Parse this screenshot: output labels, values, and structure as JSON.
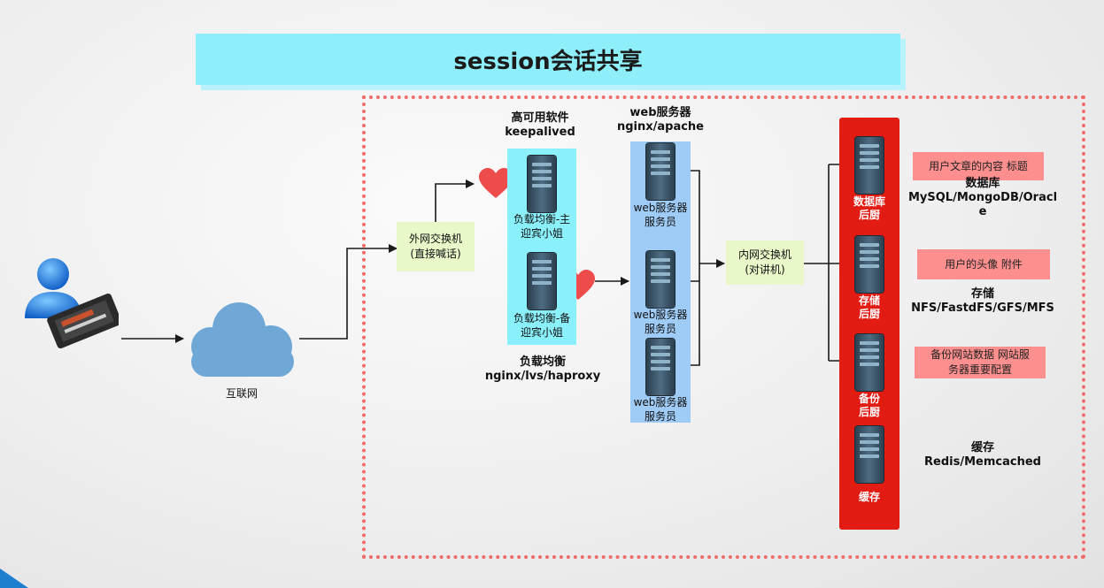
{
  "title": "session会话共享",
  "internet_label": "互联网",
  "outer_switch": {
    "line1": "外网交换机",
    "line2": "(直接喊话)"
  },
  "ha_software": {
    "line1": "高可用软件",
    "line2": "keepalived"
  },
  "lb": {
    "primary": {
      "line1": "负载均衡-主",
      "line2": "迎宾小姐"
    },
    "backup": {
      "line1": "负载均衡-备",
      "line2": "迎宾小姐"
    },
    "caption": {
      "line1": "负载均衡",
      "line2": "nginx/lvs/haproxy"
    }
  },
  "web_header": {
    "line1": "web服务器",
    "line2": "nginx/apache"
  },
  "web_servers": [
    {
      "line1": "web服务器",
      "line2": "服务员"
    },
    {
      "line1": "web服务器",
      "line2": "服务员"
    },
    {
      "line1": "web服务器",
      "line2": "服务员"
    }
  ],
  "inner_switch": {
    "line1": "内网交换机",
    "line2": "(对讲机)"
  },
  "backends": [
    {
      "line1": "数据库",
      "line2": "后厨"
    },
    {
      "line1": "存储",
      "line2": "后厨"
    },
    {
      "line1": "备份",
      "line2": "后厨"
    },
    {
      "line1": "缓存",
      "line2": ""
    }
  ],
  "notes": [
    {
      "text": "用户文章的内容 标题"
    },
    {
      "text": "用户的头像 附件"
    },
    {
      "line1": "备份网站数据 网站服",
      "line2": "务器重要配置"
    }
  ],
  "right_labels": [
    {
      "line1": "数据库",
      "line2": "MySQL/MongoDB/Oracl",
      "line3": "e"
    },
    {
      "line1": "存储",
      "line2": "NFS/FastdFS/GFS/MFS"
    },
    {
      "line1": "缓存",
      "line2": "Redis/Memcached"
    }
  ],
  "colors": {
    "title_band": "#8eeefa",
    "dashed_border": "#f26b6b",
    "lb_panel": "#8af0fb",
    "web_panel": "#9fccf7",
    "backend_panel": "#e21b13",
    "note_bg": "#fd8f8f",
    "switch_bg": "#e9f8c9",
    "cloud": "#6fa8d6",
    "heart": "#ee4b4b"
  }
}
